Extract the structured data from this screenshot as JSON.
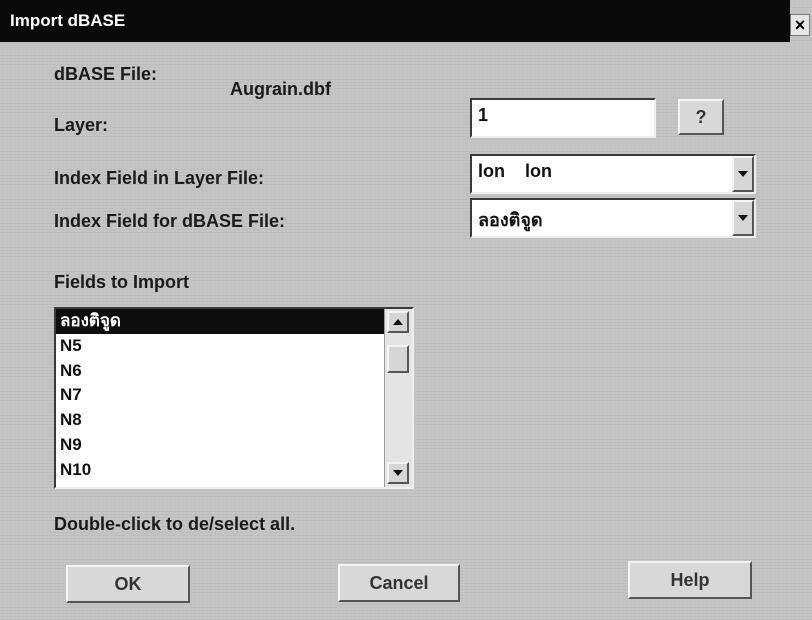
{
  "window": {
    "title": "Import dBASE",
    "close_glyph": "×"
  },
  "form": {
    "dbase_file_label": "dBASE File:",
    "dbase_file_value": "Augrain.dbf",
    "layer_label": "Layer:",
    "layer_value": "1",
    "layer_help_label": "?",
    "index_layer_label": "Index Field in Layer File:",
    "index_layer_value": "lon    lon",
    "index_dbase_label": "Index Field for dBASE File:",
    "index_dbase_value": "ลองติจูด",
    "fields_label": "Fields to Import",
    "fields": [
      "ลองติจูด",
      "N5",
      "N6",
      "N7",
      "N8",
      "N9",
      "N10"
    ],
    "selected_index": 0,
    "hint": "Double-click to de/select all."
  },
  "buttons": {
    "ok": "OK",
    "cancel": "Cancel",
    "help": "Help"
  },
  "icons": {
    "close": "close-icon",
    "dropdown": "chevron-down-icon",
    "scroll_up": "scroll-up-icon",
    "scroll_down": "scroll-down-icon"
  },
  "colors": {
    "titlebar": "#0a0a0a",
    "dialog_bg": "#c4c4c4",
    "selection": "#0d0d0d"
  }
}
